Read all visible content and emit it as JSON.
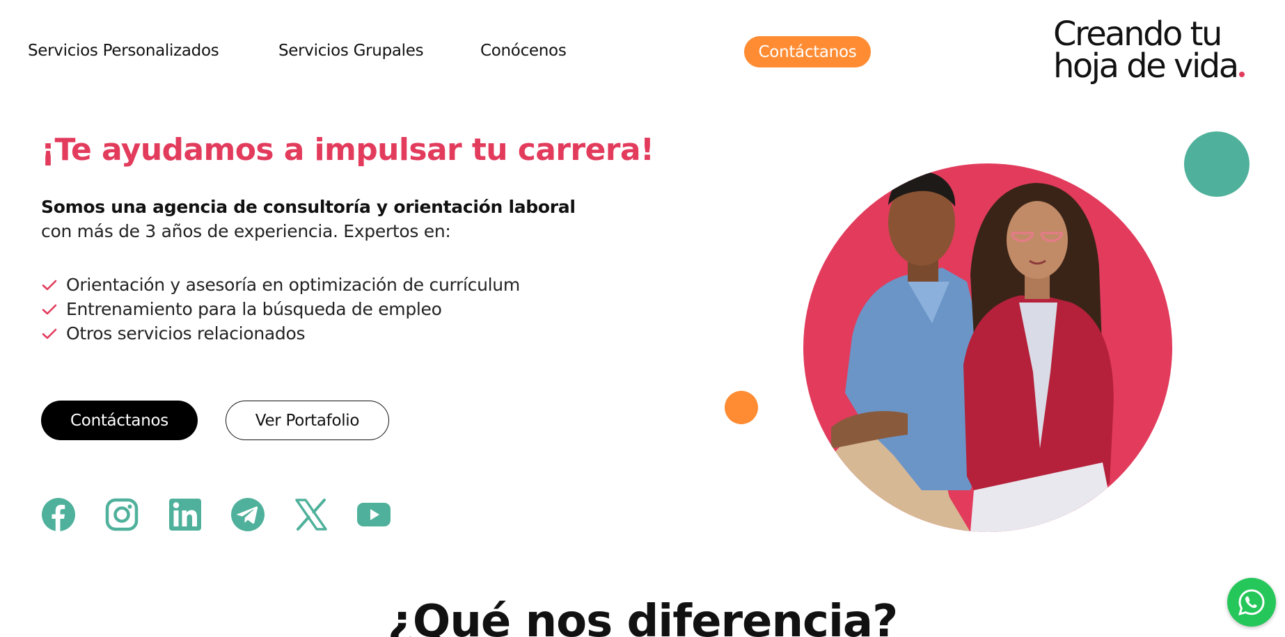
{
  "nav": {
    "links": [
      {
        "label": "Servicios Personalizados"
      },
      {
        "label": "Servicios Grupales"
      },
      {
        "label": "Conócenos"
      }
    ],
    "cta": "Contáctanos",
    "logo": {
      "line1": "Creando tu",
      "line2": "hoja de vida"
    }
  },
  "hero": {
    "title": "¡Te ayudamos a impulsar tu carrera!",
    "intro_bold": "Somos una agencia de consultoría y orientación laboral",
    "intro_text": "con más de 3 años de experiencia. Expertos en:",
    "features": [
      "Orientación y asesoría en optimización de currículum",
      "Entrenamiento para la búsqueda de empleo",
      "Otros servicios relacionados"
    ],
    "primary_button": "Contáctanos",
    "secondary_button": "Ver Portafolio"
  },
  "social": [
    "facebook-icon",
    "instagram-icon",
    "linkedin-icon",
    "telegram-icon",
    "x-icon",
    "youtube-icon"
  ],
  "section": {
    "title": "¿Qué nos diferencia?"
  },
  "colors": {
    "accent_red": "#E23B5C",
    "accent_orange": "#FF8C33",
    "accent_teal": "#4FB19B",
    "whatsapp_green": "#25C65A"
  }
}
